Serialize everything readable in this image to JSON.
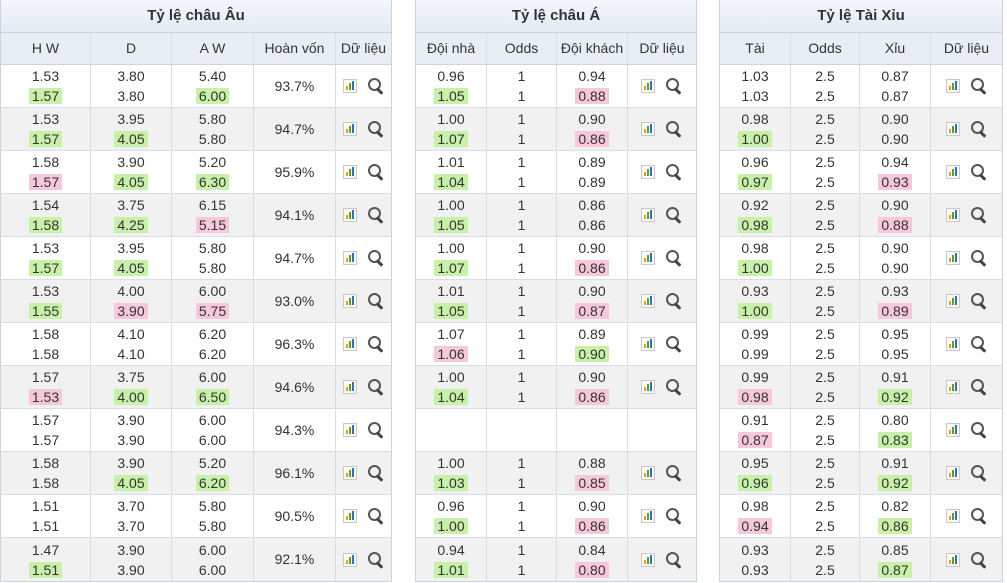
{
  "panels": [
    {
      "id": "euro",
      "title": "Tỷ lệ châu Âu",
      "headers": [
        "H W",
        "D",
        "A W",
        "Hoàn vốn",
        "Dữ liệu"
      ],
      "rows": [
        {
          "hw": [
            "1.53",
            "1.57"
          ],
          "d": [
            "3.80",
            "3.80"
          ],
          "aw": [
            "5.40",
            "6.00"
          ],
          "payout": "93.7%",
          "hl": {
            "hw": [
              null,
              "green"
            ],
            "d": [
              null,
              null
            ],
            "aw": [
              null,
              "green"
            ]
          }
        },
        {
          "hw": [
            "1.53",
            "1.57"
          ],
          "d": [
            "3.95",
            "4.05"
          ],
          "aw": [
            "5.80",
            "5.80"
          ],
          "payout": "94.7%",
          "hl": {
            "hw": [
              null,
              "green"
            ],
            "d": [
              null,
              "green"
            ],
            "aw": [
              null,
              null
            ]
          }
        },
        {
          "hw": [
            "1.58",
            "1.57"
          ],
          "d": [
            "3.90",
            "4.05"
          ],
          "aw": [
            "5.20",
            "6.30"
          ],
          "payout": "95.9%",
          "hl": {
            "hw": [
              null,
              "pink"
            ],
            "d": [
              null,
              "green"
            ],
            "aw": [
              null,
              "green"
            ]
          }
        },
        {
          "hw": [
            "1.54",
            "1.58"
          ],
          "d": [
            "3.75",
            "4.25"
          ],
          "aw": [
            "6.15",
            "5.15"
          ],
          "payout": "94.1%",
          "hl": {
            "hw": [
              null,
              "green"
            ],
            "d": [
              null,
              "green"
            ],
            "aw": [
              null,
              "pink"
            ]
          }
        },
        {
          "hw": [
            "1.53",
            "1.57"
          ],
          "d": [
            "3.95",
            "4.05"
          ],
          "aw": [
            "5.80",
            "5.80"
          ],
          "payout": "94.7%",
          "hl": {
            "hw": [
              null,
              "green"
            ],
            "d": [
              null,
              "green"
            ],
            "aw": [
              null,
              null
            ]
          }
        },
        {
          "hw": [
            "1.53",
            "1.55"
          ],
          "d": [
            "4.00",
            "3.90"
          ],
          "aw": [
            "6.00",
            "5.75"
          ],
          "payout": "93.0%",
          "hl": {
            "hw": [
              null,
              "green"
            ],
            "d": [
              null,
              "pink"
            ],
            "aw": [
              null,
              "pink"
            ]
          }
        },
        {
          "hw": [
            "1.58",
            "1.58"
          ],
          "d": [
            "4.10",
            "4.10"
          ],
          "aw": [
            "6.20",
            "6.20"
          ],
          "payout": "96.3%",
          "hl": {
            "hw": [
              null,
              null
            ],
            "d": [
              null,
              null
            ],
            "aw": [
              null,
              null
            ]
          }
        },
        {
          "hw": [
            "1.57",
            "1.53"
          ],
          "d": [
            "3.75",
            "4.00"
          ],
          "aw": [
            "6.00",
            "6.50"
          ],
          "payout": "94.6%",
          "hl": {
            "hw": [
              null,
              "pink"
            ],
            "d": [
              null,
              "green"
            ],
            "aw": [
              null,
              "green"
            ]
          }
        },
        {
          "hw": [
            "1.57",
            "1.57"
          ],
          "d": [
            "3.90",
            "3.90"
          ],
          "aw": [
            "6.00",
            "6.00"
          ],
          "payout": "94.3%",
          "hl": {
            "hw": [
              null,
              null
            ],
            "d": [
              null,
              null
            ],
            "aw": [
              null,
              null
            ]
          }
        },
        {
          "hw": [
            "1.58",
            "1.58"
          ],
          "d": [
            "3.90",
            "4.05"
          ],
          "aw": [
            "5.20",
            "6.20"
          ],
          "payout": "96.1%",
          "hl": {
            "hw": [
              null,
              null
            ],
            "d": [
              null,
              "green"
            ],
            "aw": [
              null,
              "green"
            ]
          }
        },
        {
          "hw": [
            "1.51",
            "1.51"
          ],
          "d": [
            "3.70",
            "3.70"
          ],
          "aw": [
            "5.80",
            "5.80"
          ],
          "payout": "90.5%",
          "hl": {
            "hw": [
              null,
              null
            ],
            "d": [
              null,
              null
            ],
            "aw": [
              null,
              null
            ]
          }
        },
        {
          "hw": [
            "1.47",
            "1.51"
          ],
          "d": [
            "3.90",
            "3.90"
          ],
          "aw": [
            "6.00",
            "6.00"
          ],
          "payout": "92.1%",
          "hl": {
            "hw": [
              null,
              "green"
            ],
            "d": [
              null,
              null
            ],
            "aw": [
              null,
              null
            ]
          }
        }
      ]
    },
    {
      "id": "asian",
      "title": "Tỷ lệ châu Á",
      "headers": [
        "Đội nhà",
        "Odds",
        "Đội khách",
        "Dữ liệu"
      ],
      "rows": [
        {
          "home": [
            "0.96",
            "1.05"
          ],
          "odds": [
            "1",
            "1"
          ],
          "away": [
            "0.94",
            "0.88"
          ],
          "hl": {
            "home": [
              null,
              "green"
            ],
            "away": [
              null,
              "pink"
            ]
          }
        },
        {
          "home": [
            "1.00",
            "1.07"
          ],
          "odds": [
            "1",
            "1"
          ],
          "away": [
            "0.90",
            "0.86"
          ],
          "hl": {
            "home": [
              null,
              "green"
            ],
            "away": [
              null,
              "pink"
            ]
          }
        },
        {
          "home": [
            "1.01",
            "1.04"
          ],
          "odds": [
            "1",
            "1"
          ],
          "away": [
            "0.89",
            "0.89"
          ],
          "hl": {
            "home": [
              null,
              "green"
            ],
            "away": [
              null,
              null
            ]
          }
        },
        {
          "home": [
            "1.00",
            "1.05"
          ],
          "odds": [
            "1",
            "1"
          ],
          "away": [
            "0.86",
            "0.86"
          ],
          "hl": {
            "home": [
              null,
              "green"
            ],
            "away": [
              null,
              null
            ]
          }
        },
        {
          "home": [
            "1.00",
            "1.07"
          ],
          "odds": [
            "1",
            "1"
          ],
          "away": [
            "0.90",
            "0.86"
          ],
          "hl": {
            "home": [
              null,
              "green"
            ],
            "away": [
              null,
              "pink"
            ]
          }
        },
        {
          "home": [
            "1.01",
            "1.05"
          ],
          "odds": [
            "1",
            "1"
          ],
          "away": [
            "0.90",
            "0.87"
          ],
          "hl": {
            "home": [
              null,
              "green"
            ],
            "away": [
              null,
              "pink"
            ]
          }
        },
        {
          "home": [
            "1.07",
            "1.06"
          ],
          "odds": [
            "1",
            "1"
          ],
          "away": [
            "0.89",
            "0.90"
          ],
          "hl": {
            "home": [
              null,
              "pink"
            ],
            "away": [
              null,
              "green"
            ]
          }
        },
        {
          "home": [
            "1.00",
            "1.04"
          ],
          "odds": [
            "1",
            "1"
          ],
          "away": [
            "0.90",
            "0.86"
          ],
          "hl": {
            "home": [
              null,
              "green"
            ],
            "away": [
              null,
              "pink"
            ]
          }
        },
        {
          "empty": true
        },
        {
          "home": [
            "1.00",
            "1.03"
          ],
          "odds": [
            "1",
            "1"
          ],
          "away": [
            "0.88",
            "0.85"
          ],
          "hl": {
            "home": [
              null,
              "green"
            ],
            "away": [
              null,
              "pink"
            ]
          }
        },
        {
          "home": [
            "0.96",
            "1.00"
          ],
          "odds": [
            "1",
            "1"
          ],
          "away": [
            "0.90",
            "0.86"
          ],
          "hl": {
            "home": [
              null,
              "green"
            ],
            "away": [
              null,
              "pink"
            ]
          }
        },
        {
          "home": [
            "0.94",
            "1.01"
          ],
          "odds": [
            "1",
            "1"
          ],
          "away": [
            "0.84",
            "0.80"
          ],
          "hl": {
            "home": [
              null,
              "green"
            ],
            "away": [
              null,
              "pink"
            ]
          }
        }
      ]
    },
    {
      "id": "ou",
      "title": "Tỷ lệ Tài Xỉu",
      "headers": [
        "Tài",
        "Odds",
        "Xỉu",
        "Dữ liệu"
      ],
      "rows": [
        {
          "over": [
            "1.03",
            "1.03"
          ],
          "odds": [
            "2.5",
            "2.5"
          ],
          "under": [
            "0.87",
            "0.87"
          ],
          "hl": {
            "over": [
              null,
              null
            ],
            "under": [
              null,
              null
            ]
          }
        },
        {
          "over": [
            "0.98",
            "1.00"
          ],
          "odds": [
            "2.5",
            "2.5"
          ],
          "under": [
            "0.90",
            "0.90"
          ],
          "hl": {
            "over": [
              null,
              "green"
            ],
            "under": [
              null,
              null
            ]
          }
        },
        {
          "over": [
            "0.96",
            "0.97"
          ],
          "odds": [
            "2.5",
            "2.5"
          ],
          "under": [
            "0.94",
            "0.93"
          ],
          "hl": {
            "over": [
              null,
              "green"
            ],
            "under": [
              null,
              "pink"
            ]
          }
        },
        {
          "over": [
            "0.92",
            "0.98"
          ],
          "odds": [
            "2.5",
            "2.5"
          ],
          "under": [
            "0.90",
            "0.88"
          ],
          "hl": {
            "over": [
              null,
              "green"
            ],
            "under": [
              null,
              "pink"
            ]
          }
        },
        {
          "over": [
            "0.98",
            "1.00"
          ],
          "odds": [
            "2.5",
            "2.5"
          ],
          "under": [
            "0.90",
            "0.90"
          ],
          "hl": {
            "over": [
              null,
              "green"
            ],
            "under": [
              null,
              null
            ]
          }
        },
        {
          "over": [
            "0.93",
            "1.00"
          ],
          "odds": [
            "2.5",
            "2.5"
          ],
          "under": [
            "0.93",
            "0.89"
          ],
          "hl": {
            "over": [
              null,
              "green"
            ],
            "under": [
              null,
              "pink"
            ]
          }
        },
        {
          "over": [
            "0.99",
            "0.99"
          ],
          "odds": [
            "2.5",
            "2.5"
          ],
          "under": [
            "0.95",
            "0.95"
          ],
          "hl": {
            "over": [
              null,
              null
            ],
            "under": [
              null,
              null
            ]
          }
        },
        {
          "over": [
            "0.99",
            "0.98"
          ],
          "odds": [
            "2.5",
            "2.5"
          ],
          "under": [
            "0.91",
            "0.92"
          ],
          "hl": {
            "over": [
              null,
              "pink"
            ],
            "under": [
              null,
              "green"
            ]
          }
        },
        {
          "over": [
            "0.91",
            "0.87"
          ],
          "odds": [
            "2.5",
            "2.5"
          ],
          "under": [
            "0.80",
            "0.83"
          ],
          "hl": {
            "over": [
              null,
              "pink"
            ],
            "under": [
              null,
              "green"
            ]
          }
        },
        {
          "over": [
            "0.95",
            "0.96"
          ],
          "odds": [
            "2.5",
            "2.5"
          ],
          "under": [
            "0.91",
            "0.92"
          ],
          "hl": {
            "over": [
              null,
              "green"
            ],
            "under": [
              null,
              "green"
            ]
          }
        },
        {
          "over": [
            "0.98",
            "0.94"
          ],
          "odds": [
            "2.5",
            "2.5"
          ],
          "under": [
            "0.82",
            "0.86"
          ],
          "hl": {
            "over": [
              null,
              "pink"
            ],
            "under": [
              null,
              "green"
            ]
          }
        },
        {
          "over": [
            "0.93",
            "0.93"
          ],
          "odds": [
            "2.5",
            "2.5"
          ],
          "under": [
            "0.85",
            "0.87"
          ],
          "hl": {
            "over": [
              null,
              null
            ],
            "under": [
              null,
              "green"
            ]
          }
        }
      ]
    }
  ],
  "icons": {
    "chart": "bar-chart-icon",
    "search": "magnifier-icon"
  },
  "colors": {
    "header_bg": "#e9eef5",
    "alt_row": "#f1f1f1",
    "rise": "#c8f0a8",
    "fall": "#f7c7da",
    "border": "#c8d4e4"
  }
}
